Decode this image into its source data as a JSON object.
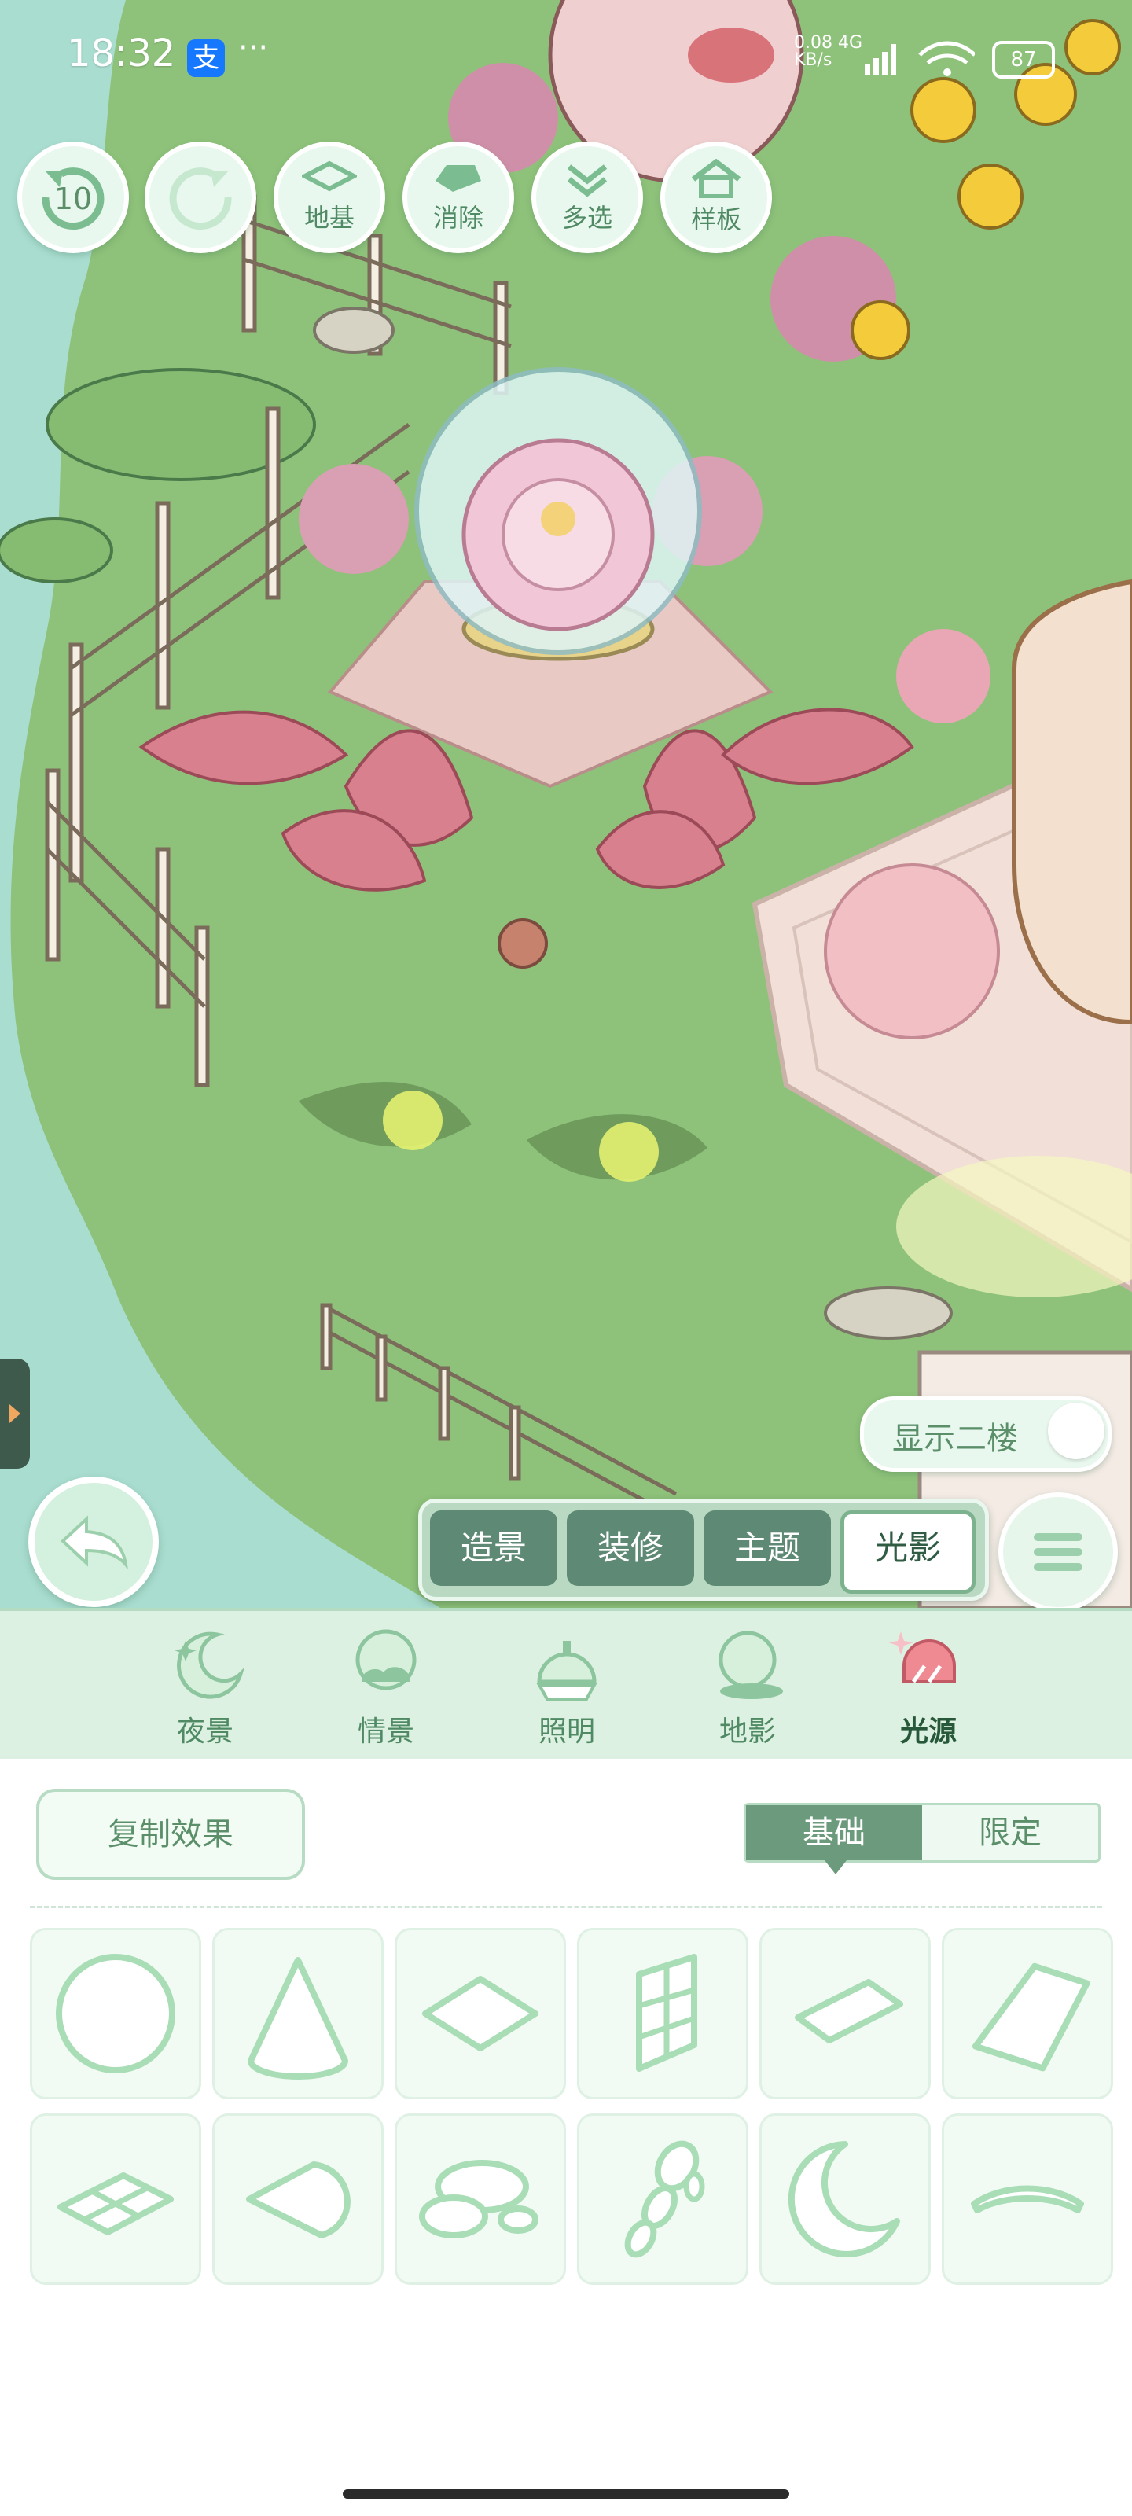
{
  "status_bar": {
    "time": "18:32",
    "alipay_glyph": "支",
    "more": "···",
    "net_speed_value": "0.08",
    "net_speed_unit": "KB/s",
    "net_type": "4G",
    "battery": "87"
  },
  "top_tools": [
    {
      "name": "undo-counter",
      "label": "10"
    },
    {
      "name": "redo",
      "label": ""
    },
    {
      "name": "foundation",
      "label": "地基"
    },
    {
      "name": "erase",
      "label": "消除"
    },
    {
      "name": "multi-select",
      "label": "多选"
    },
    {
      "name": "template",
      "label": "样板"
    }
  ],
  "floor_toggle": {
    "label": "显示二楼",
    "on": false
  },
  "mode_tabs": [
    {
      "label": "造景",
      "active": false
    },
    {
      "label": "装修",
      "active": false
    },
    {
      "label": "主题",
      "active": false
    },
    {
      "label": "光影",
      "active": true
    }
  ],
  "categories": [
    {
      "label": "夜景",
      "icon": "moon-icon",
      "active": false
    },
    {
      "label": "情景",
      "icon": "weather-icon",
      "active": false
    },
    {
      "label": "照明",
      "icon": "lamp-icon",
      "active": false
    },
    {
      "label": "地影",
      "icon": "shadow-icon",
      "active": false
    },
    {
      "label": "光源",
      "icon": "light-source-icon",
      "active": true
    }
  ],
  "panel": {
    "copy_label": "复制效果",
    "seg_basic": "基础",
    "seg_limited": "限定",
    "selected_segment": "基础"
  },
  "shapes": [
    "circle-shape",
    "cone-shape",
    "diamond-shape",
    "window-shape",
    "flat-diamond-shape",
    "trapezoid-shape",
    "tile-grid-shape",
    "leaf-shape",
    "cloud-shape",
    "bubbles-shape",
    "crescent-shape",
    "arc-shape"
  ],
  "colors": {
    "accent_green": "#6c9a7c",
    "light_green": "#e9f8ee",
    "outline_green": "#a8ddb6"
  }
}
